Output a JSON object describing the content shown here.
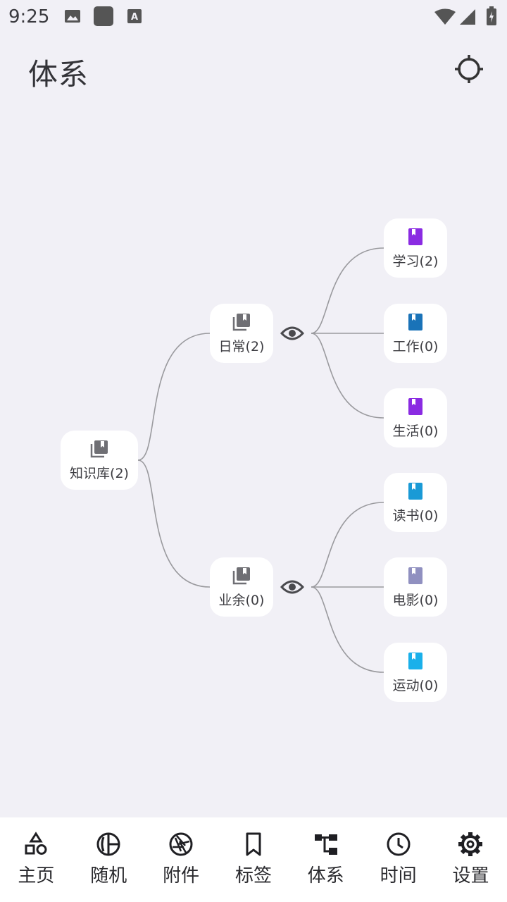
{
  "status_bar": {
    "time": "9:25"
  },
  "header": {
    "title": "体系"
  },
  "mindmap": {
    "root": {
      "label": "知识库(2)"
    },
    "groups": [
      {
        "label": "日常(2)",
        "children": [
          {
            "label": "学习(2)",
            "color": "#8a2be2"
          },
          {
            "label": "工作(0)",
            "color": "#1a73b8"
          },
          {
            "label": "生活(0)",
            "color": "#8a2be2"
          }
        ]
      },
      {
        "label": "业余(0)",
        "children": [
          {
            "label": "读书(0)",
            "color": "#1a9ad6"
          },
          {
            "label": "电影(0)",
            "color": "#9090c0"
          },
          {
            "label": "运动(0)",
            "color": "#1ab0ea"
          }
        ]
      }
    ]
  },
  "bottom_nav": {
    "items": [
      {
        "label": "主页",
        "icon": "shapes-icon"
      },
      {
        "label": "随机",
        "icon": "random-icon"
      },
      {
        "label": "附件",
        "icon": "shutter-icon"
      },
      {
        "label": "标签",
        "icon": "bookmark-icon"
      },
      {
        "label": "体系",
        "icon": "hierarchy-icon"
      },
      {
        "label": "时间",
        "icon": "clock-icon"
      },
      {
        "label": "设置",
        "icon": "gear-icon"
      }
    ],
    "active": "体系"
  }
}
